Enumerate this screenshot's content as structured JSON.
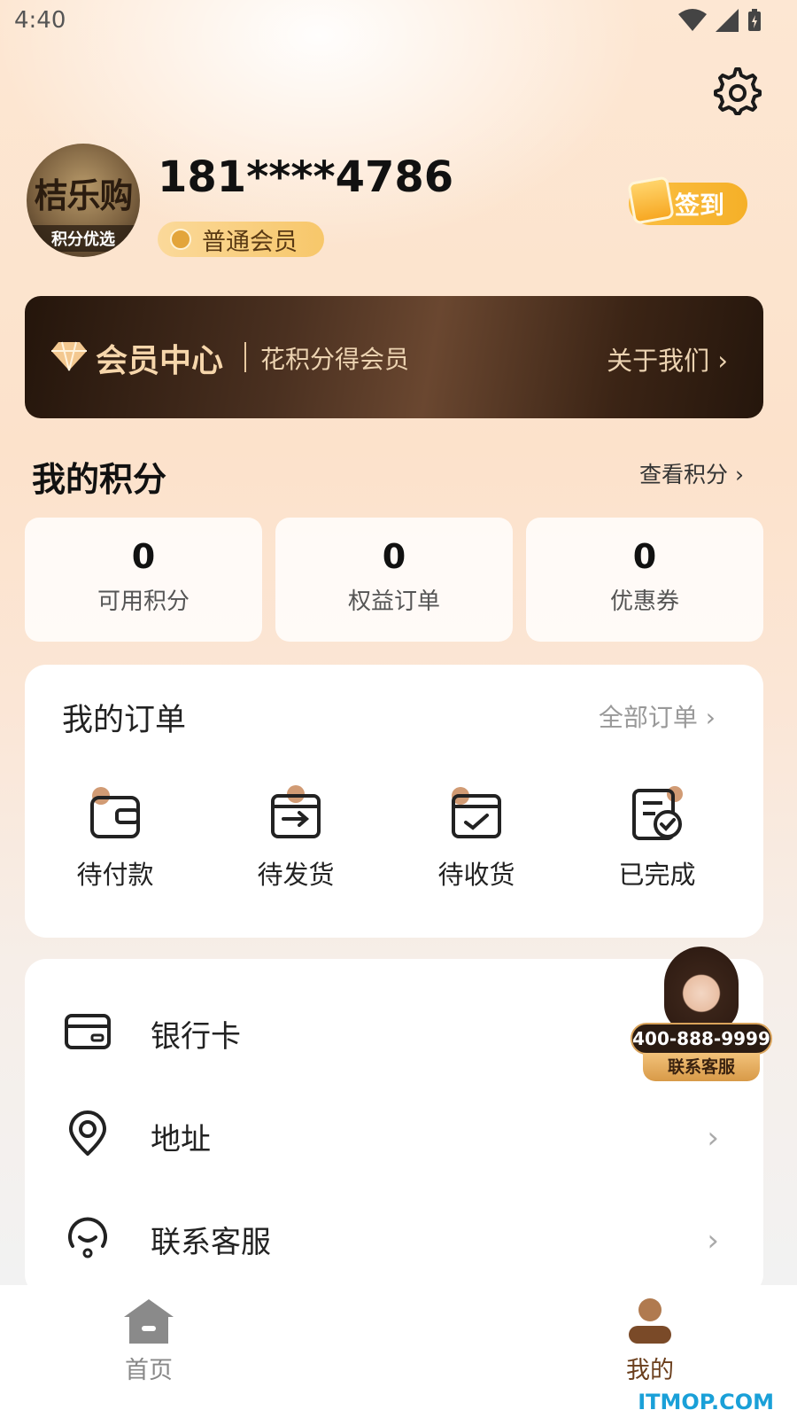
{
  "status_bar": {
    "time": "4:40"
  },
  "profile": {
    "avatar_logo_main": "桔乐购",
    "avatar_logo_sub": "积分优选",
    "phone": "181****4786",
    "member_level": "普通会员",
    "checkin_label": "签到"
  },
  "banner": {
    "title": "会员中心",
    "subtitle": "花积分得会员",
    "about_label": "关于我们 ›"
  },
  "points": {
    "title": "我的积分",
    "view_label": "查看积分 ›",
    "cards": [
      {
        "value": "0",
        "label": "可用积分"
      },
      {
        "value": "0",
        "label": "权益订单"
      },
      {
        "value": "0",
        "label": "优惠券"
      }
    ]
  },
  "orders": {
    "title": "我的订单",
    "all_label": "全部订单 ›",
    "items": [
      {
        "label": "待付款",
        "icon": "wallet-icon"
      },
      {
        "label": "待发货",
        "icon": "box-send-icon"
      },
      {
        "label": "待收货",
        "icon": "box-receive-icon"
      },
      {
        "label": "已完成",
        "icon": "completed-doc-icon"
      }
    ]
  },
  "menu": {
    "items": [
      {
        "label": "银行卡",
        "icon": "bank-card-icon"
      },
      {
        "label": "地址",
        "icon": "location-icon"
      },
      {
        "label": "联系客服",
        "icon": "customer-service-icon"
      }
    ]
  },
  "customer_service_float": {
    "phone": "400-888-9999",
    "label": "联系客服"
  },
  "bottom_nav": {
    "items": [
      {
        "label": "首页",
        "icon": "home-icon",
        "active": false
      },
      {
        "label": "我的",
        "icon": "user-icon",
        "active": true
      }
    ]
  },
  "watermark": "ITMOP.COM",
  "colors": {
    "accent_gold": "#f5b028",
    "banner_dark": "#24150b",
    "nav_active": "#6b3f1d",
    "nav_inactive": "#888888"
  }
}
